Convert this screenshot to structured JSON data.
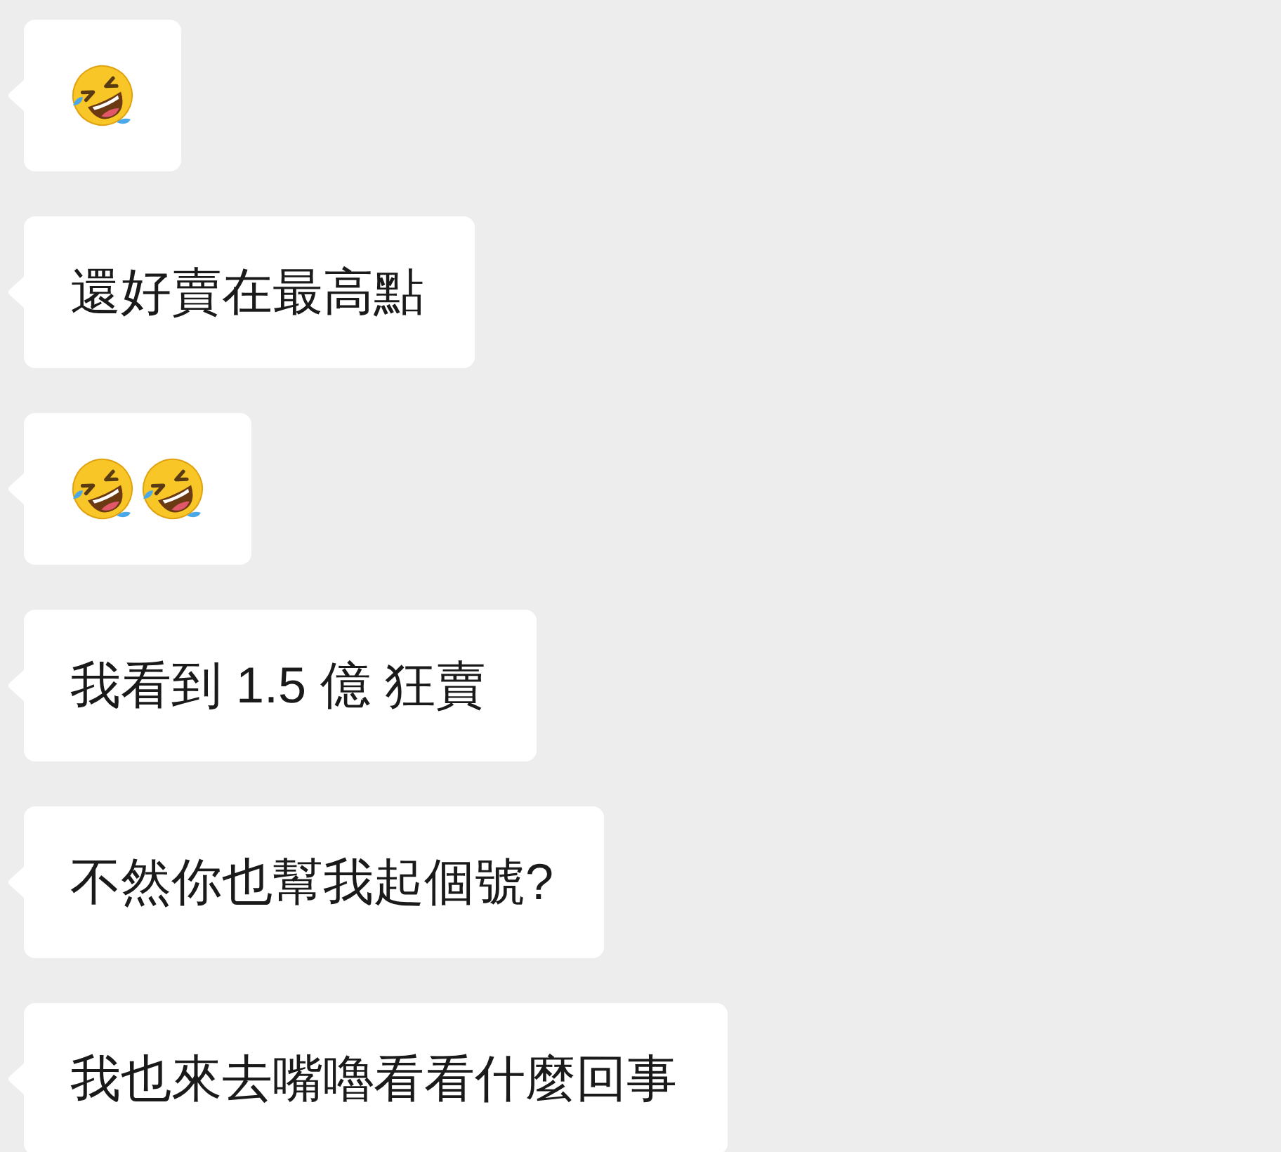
{
  "messages": [
    {
      "kind": "emoji",
      "icons": [
        {
          "kind": "laughing"
        }
      ]
    },
    {
      "kind": "text",
      "text": "還好賣在最高點"
    },
    {
      "kind": "emoji",
      "icons": [
        {
          "kind": "laughing"
        },
        {
          "kind": "laughing"
        }
      ]
    },
    {
      "kind": "text",
      "text": "我看到 1.5 億 狂賣"
    },
    {
      "kind": "text",
      "text": "不然你也幫我起個號?"
    },
    {
      "kind": "text",
      "text": "我也來去嘴嚕看看什麼回事"
    }
  ]
}
